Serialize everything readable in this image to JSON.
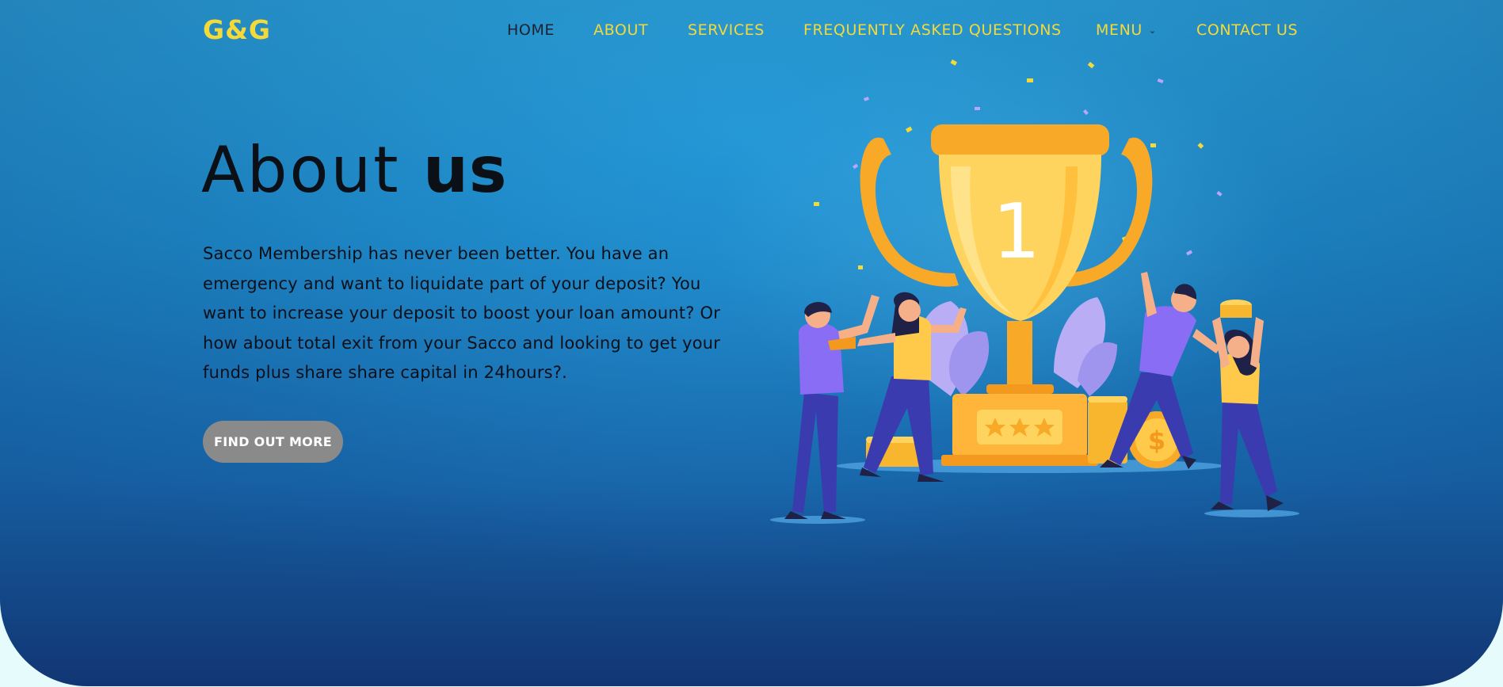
{
  "logo": "G&G",
  "nav": {
    "items": [
      {
        "label": "HOME"
      },
      {
        "label": "ABOUT"
      },
      {
        "label": "SERVICES"
      },
      {
        "label": "FREQUENTLY ASKED QUESTIONS"
      },
      {
        "label": "MENU"
      },
      {
        "label": "CONTACT US"
      }
    ],
    "active": "HOME",
    "menu_icon": "chevron-down-icon"
  },
  "hero": {
    "title_light": "About ",
    "title_bold": "us",
    "description": "Sacco Membership has never been better. You have an emergency and want to liquidate part of your deposit? You want to increase your deposit to boost your loan amount? Or how about total exit from your Sacco and looking to get your funds plus share share capital in 24hours?.",
    "button_label": "FIND OUT MORE"
  },
  "illustration": {
    "trophy_number": "1",
    "rating_stars": 3,
    "coin_symbol": "$"
  },
  "colors": {
    "accent_yellow": "#f3d93a",
    "background_blue": "#1f8fd0",
    "button_gray": "#8a8a8a",
    "page_bottom": "#e6fbfb"
  }
}
